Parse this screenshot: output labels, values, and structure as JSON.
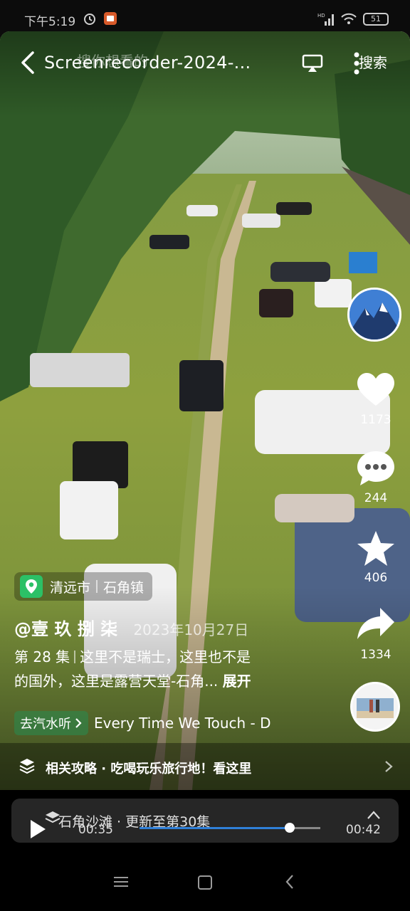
{
  "status_bar": {
    "time": "下午5:19",
    "battery": "51",
    "network": "HD"
  },
  "video": {
    "title": "Screenrecorder-2024-...",
    "search_placeholder": "搜你想看的",
    "search_label": "搜索",
    "location": {
      "city": "清远市",
      "town": "石角镇"
    },
    "author": "@壹 玖 捌 柒",
    "date": "2023年10月27日",
    "description": {
      "episode": "第 28 集",
      "line1": "这里不是瑞士，这里也不是",
      "line2": "的国外，这里是露营天堂-石角...",
      "expand": "展开"
    },
    "music": {
      "pill": "去汽水听",
      "title": "Every Time We Touch - D"
    },
    "guide": "相关攻略 · 吃喝玩乐旅行地！看这里"
  },
  "actions": {
    "likes": "1173",
    "comments": "244",
    "favorites": "406",
    "shares": "1334"
  },
  "player": {
    "playlist": "石角沙滩 · 更新至第30集",
    "current_time": "00:35",
    "total_time": "00:42",
    "progress": 0.83
  },
  "colors": {
    "accent": "#2f7fd8",
    "location_icon": "#2cc066"
  }
}
